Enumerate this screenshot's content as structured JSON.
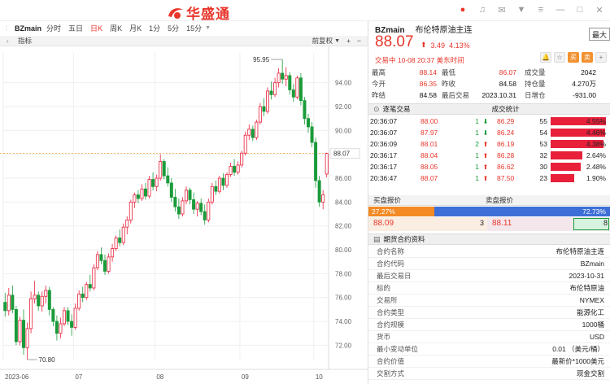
{
  "app": {
    "brand": "华盛通"
  },
  "toolbar": {
    "symbol": "BZmain",
    "periods": [
      {
        "label": "分时",
        "active": false
      },
      {
        "label": "五日",
        "active": false
      },
      {
        "label": "日K",
        "active": true
      },
      {
        "label": "周K",
        "active": false
      },
      {
        "label": "月K",
        "active": false
      },
      {
        "label": "1分",
        "active": false
      },
      {
        "label": "5分",
        "active": false
      },
      {
        "label": "15分",
        "active": false
      }
    ]
  },
  "indicator_bar": {
    "label": "指标",
    "adjust": "前复权",
    "plus": "+",
    "minus": "−"
  },
  "quote": {
    "symbol": "BZmain",
    "name": "布伦特原油主连",
    "price": "88.07",
    "change": "3.49",
    "change_pct": "4.13%",
    "status": "交易中 10-08 20:37 美东时间",
    "max_button": "最大",
    "action_icons": [
      "bell-icon",
      "star-icon",
      "buy-button",
      "sell-button",
      "add-icon"
    ],
    "action_labels": {
      "buy": "买",
      "sell": "卖",
      "bell": "🔔",
      "star": "☆",
      "add": "+"
    }
  },
  "stats": [
    [
      {
        "k": "最高",
        "v": "88.14",
        "c": "red"
      },
      {
        "k": "最低",
        "v": "86.07",
        "c": "red"
      },
      {
        "k": "成交量",
        "v": "2042",
        "c": "blk"
      }
    ],
    [
      {
        "k": "今开",
        "v": "86.35",
        "c": "red"
      },
      {
        "k": "昨收",
        "v": "84.58",
        "c": "blk"
      },
      {
        "k": "持仓量",
        "v": "4.270万",
        "c": "blk"
      }
    ],
    [
      {
        "k": "昨结",
        "v": "84.58",
        "c": "blk"
      },
      {
        "k": "最后交易",
        "v": "2023.10.31",
        "c": "blk"
      },
      {
        "k": "日增仓",
        "v": "-931.00",
        "c": "blk"
      }
    ]
  ],
  "sections": {
    "ticks": "逐笔交易",
    "deal_stats": "成交统计",
    "bid": "买盘报价",
    "ask": "卖盘报价",
    "spec": "期货合约资料"
  },
  "ticks": [
    {
      "time": "20:36:07",
      "price": "88.00",
      "vol": "1",
      "dir": "down",
      "bprice": "86.29",
      "cnt": "55",
      "pct": "4.55%",
      "ratio": 0.97
    },
    {
      "time": "20:36:07",
      "price": "87.97",
      "vol": "1",
      "dir": "down",
      "bprice": "86.24",
      "cnt": "54",
      "pct": "4.46%",
      "ratio": 0.95
    },
    {
      "time": "20:36:09",
      "price": "88.01",
      "vol": "2",
      "dir": "up",
      "bprice": "86.19",
      "cnt": "53",
      "pct": "4.38%",
      "ratio": 0.93
    },
    {
      "time": "20:36:17",
      "price": "88.04",
      "vol": "1",
      "dir": "up",
      "bprice": "86.28",
      "cnt": "32",
      "pct": "2.64%",
      "ratio": 0.56
    },
    {
      "time": "20:36:17",
      "price": "88.05",
      "vol": "1",
      "dir": "up",
      "bprice": "86.62",
      "cnt": "30",
      "pct": "2.48%",
      "ratio": 0.53
    },
    {
      "time": "20:36:47",
      "price": "88.07",
      "vol": "1",
      "dir": "up",
      "bprice": "87.50",
      "cnt": "23",
      "pct": "1.90%",
      "ratio": 0.41
    }
  ],
  "bidask": {
    "buy_ratio": "27.27%",
    "sell_ratio": "72.73%",
    "buy_frac": 0.2727,
    "bid_price": "88.09",
    "bid_qty": "3",
    "ask_price": "88.11",
    "ask_qty": "8"
  },
  "spec": [
    {
      "k": "合约名称",
      "v": "布伦特原油主连"
    },
    {
      "k": "合约代码",
      "v": "BZmain"
    },
    {
      "k": "最后交易日",
      "v": "2023-10-31"
    },
    {
      "k": "标的",
      "v": "布伦特原油"
    },
    {
      "k": "交易所",
      "v": "NYMEX"
    },
    {
      "k": "合约类型",
      "v": "能源化工"
    },
    {
      "k": "合约规模",
      "v": "1000桶"
    },
    {
      "k": "货币",
      "v": "USD"
    },
    {
      "k": "最小变动单位",
      "v": "0.01 （美元/桶）"
    },
    {
      "k": "合约价值",
      "v": "最新价*1000美元"
    },
    {
      "k": "交割方式",
      "v": "现金交割"
    }
  ],
  "chart_data": {
    "type": "candlestick",
    "yticks": [
      "94.00",
      "92.00",
      "90.00",
      "88.00",
      "86.00",
      "84.00",
      "82.00",
      "80.00",
      "78.00",
      "76.00",
      "74.00",
      "72.00"
    ],
    "yrange": [
      70.8,
      96.5
    ],
    "xticks": [
      {
        "label": "2023-06",
        "i": 0
      },
      {
        "label": "07",
        "i": 19
      },
      {
        "label": "08",
        "i": 41
      },
      {
        "label": "09",
        "i": 64
      },
      {
        "label": "10",
        "i": 84
      }
    ],
    "current_price": 88.07,
    "current_label": "88.07",
    "high_label": "95.95",
    "low_label": "70.80",
    "candles": [
      [
        75.6,
        76.4,
        74.4,
        74.9
      ],
      [
        74.9,
        76.8,
        74.5,
        76.2
      ],
      [
        76.2,
        77.0,
        74.7,
        75.0
      ],
      [
        75.0,
        75.3,
        72.0,
        72.3
      ],
      [
        72.3,
        74.4,
        72.0,
        74.1
      ],
      [
        74.1,
        75.0,
        71.2,
        71.8
      ],
      [
        71.8,
        73.9,
        70.8,
        73.4
      ],
      [
        73.4,
        76.5,
        73.0,
        75.9
      ],
      [
        75.9,
        77.4,
        75.5,
        76.2
      ],
      [
        76.2,
        76.5,
        74.9,
        75.3
      ],
      [
        75.3,
        76.5,
        74.8,
        76.1
      ],
      [
        76.1,
        77.0,
        75.5,
        76.6
      ],
      [
        76.6,
        76.9,
        74.5,
        75.0
      ],
      [
        75.0,
        75.2,
        73.6,
        74.0
      ],
      [
        74.0,
        74.5,
        72.4,
        73.0
      ],
      [
        73.0,
        74.3,
        72.6,
        73.8
      ],
      [
        73.8,
        75.2,
        73.6,
        74.9
      ],
      [
        74.9,
        75.2,
        73.7,
        74.0
      ],
      [
        74.0,
        74.6,
        72.8,
        73.5
      ],
      [
        73.5,
        75.5,
        73.3,
        75.1
      ],
      [
        75.1,
        76.6,
        74.9,
        76.3
      ],
      [
        76.3,
        76.9,
        75.6,
        76.0
      ],
      [
        76.0,
        77.3,
        75.8,
        77.1
      ],
      [
        77.1,
        77.9,
        76.5,
        76.8
      ],
      [
        76.8,
        78.8,
        76.6,
        78.5
      ],
      [
        78.5,
        79.9,
        78.3,
        79.6
      ],
      [
        79.6,
        80.2,
        78.8,
        79.1
      ],
      [
        79.1,
        79.6,
        77.9,
        78.2
      ],
      [
        78.2,
        79.7,
        78.0,
        79.4
      ],
      [
        79.4,
        80.5,
        79.0,
        80.1
      ],
      [
        80.1,
        81.2,
        79.9,
        81.0
      ],
      [
        81.0,
        81.7,
        80.3,
        80.6
      ],
      [
        80.6,
        82.2,
        80.4,
        81.9
      ],
      [
        81.9,
        82.8,
        81.3,
        82.5
      ],
      [
        82.5,
        84.2,
        82.2,
        84.0
      ],
      [
        84.0,
        84.8,
        83.5,
        84.6
      ],
      [
        84.6,
        85.0,
        83.9,
        84.3
      ],
      [
        84.3,
        85.5,
        84.1,
        85.1
      ],
      [
        85.1,
        85.6,
        84.2,
        84.5
      ],
      [
        84.5,
        86.2,
        84.3,
        85.9
      ],
      [
        85.9,
        86.5,
        85.0,
        85.3
      ],
      [
        85.3,
        86.3,
        84.9,
        86.0
      ],
      [
        86.0,
        88.0,
        85.8,
        87.4
      ],
      [
        87.4,
        87.6,
        85.9,
        86.2
      ],
      [
        86.2,
        86.9,
        85.3,
        85.6
      ],
      [
        85.6,
        86.0,
        84.0,
        84.4
      ],
      [
        84.4,
        85.1,
        83.2,
        83.6
      ],
      [
        83.6,
        84.3,
        82.6,
        83.0
      ],
      [
        83.0,
        84.4,
        82.8,
        84.1
      ],
      [
        84.1,
        85.3,
        83.8,
        85.0
      ],
      [
        85.0,
        85.2,
        83.8,
        84.2
      ],
      [
        84.2,
        84.8,
        83.0,
        83.4
      ],
      [
        83.4,
        84.1,
        82.8,
        83.9
      ],
      [
        83.9,
        84.3,
        82.9,
        83.2
      ],
      [
        83.2,
        83.8,
        82.1,
        82.5
      ],
      [
        82.5,
        84.3,
        82.3,
        84.0
      ],
      [
        84.0,
        85.6,
        83.8,
        85.3
      ],
      [
        85.3,
        85.8,
        84.6,
        84.9
      ],
      [
        84.9,
        86.2,
        84.7,
        86.0
      ],
      [
        86.0,
        86.4,
        85.0,
        85.4
      ],
      [
        85.4,
        86.5,
        85.2,
        86.3
      ],
      [
        86.3,
        87.3,
        86.1,
        87.0
      ],
      [
        87.0,
        87.6,
        86.2,
        86.5
      ],
      [
        86.5,
        87.4,
        86.3,
        87.1
      ],
      [
        87.1,
        88.3,
        86.9,
        88.1
      ],
      [
        88.1,
        89.9,
        87.9,
        89.6
      ],
      [
        89.6,
        90.5,
        89.2,
        90.1
      ],
      [
        90.1,
        90.4,
        89.1,
        89.4
      ],
      [
        89.4,
        90.9,
        89.2,
        90.7
      ],
      [
        90.7,
        92.3,
        90.5,
        92.0
      ],
      [
        92.0,
        92.7,
        91.2,
        91.6
      ],
      [
        91.6,
        93.6,
        91.4,
        93.3
      ],
      [
        93.3,
        94.1,
        92.6,
        93.0
      ],
      [
        93.0,
        94.4,
        92.8,
        94.0
      ],
      [
        94.0,
        95.2,
        93.6,
        94.8
      ],
      [
        94.8,
        95.95,
        93.9,
        94.3
      ],
      [
        94.3,
        95.3,
        93.7,
        94.6
      ],
      [
        94.6,
        94.9,
        93.0,
        93.4
      ],
      [
        93.4,
        93.9,
        92.4,
        92.8
      ],
      [
        92.8,
        94.6,
        92.6,
        94.4
      ],
      [
        94.4,
        94.8,
        92.1,
        92.5
      ],
      [
        92.5,
        92.8,
        90.5,
        91.0
      ],
      [
        91.0,
        91.4,
        89.8,
        90.3
      ],
      [
        90.3,
        90.7,
        88.6,
        89.0
      ],
      [
        89.0,
        89.4,
        85.2,
        85.8
      ],
      [
        85.8,
        86.2,
        83.6,
        84.0
      ],
      [
        84.0,
        85.0,
        83.4,
        84.6
      ],
      [
        86.35,
        88.14,
        86.07,
        88.07
      ]
    ]
  }
}
